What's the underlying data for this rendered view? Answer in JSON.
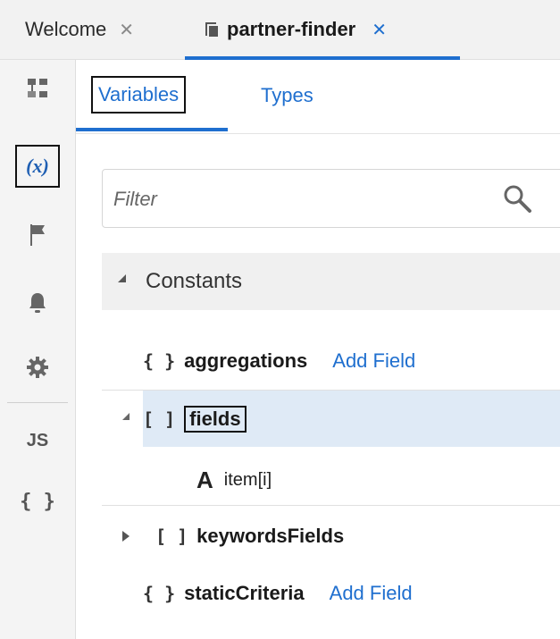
{
  "tabs": [
    {
      "label": "Welcome",
      "close": "✕"
    },
    {
      "label": "partner-finder",
      "close": "✕"
    }
  ],
  "rail": {
    "variables_icon": "(x)",
    "js_label": "JS",
    "json_label": "{ }"
  },
  "subtabs": {
    "variables": "Variables",
    "types": "Types"
  },
  "filter": {
    "placeholder": "Filter",
    "value": ""
  },
  "section": {
    "label": "Constants"
  },
  "tree": [
    {
      "glyph": "{ }",
      "name": "aggregations",
      "action": "Add Field"
    },
    {
      "glyph": "[ ]",
      "name": "fields"
    },
    {
      "glyph": "A",
      "name": "item[i]"
    },
    {
      "glyph": "[ ]",
      "name": "keywordsFields"
    },
    {
      "glyph": "{ }",
      "name": "staticCriteria",
      "action": "Add Field"
    }
  ],
  "colors": {
    "accent": "#1f6fcf",
    "selected_row": "#dfeaf6",
    "rail_bg": "#f4f4f4",
    "tabbar_bg": "#f2f2f2"
  },
  "icons": [
    "file-tree-icon",
    "variables-icon",
    "flag-icon",
    "bell-icon",
    "gear-icon",
    "js-icon",
    "json-icon",
    "search-icon",
    "page-icon"
  ]
}
